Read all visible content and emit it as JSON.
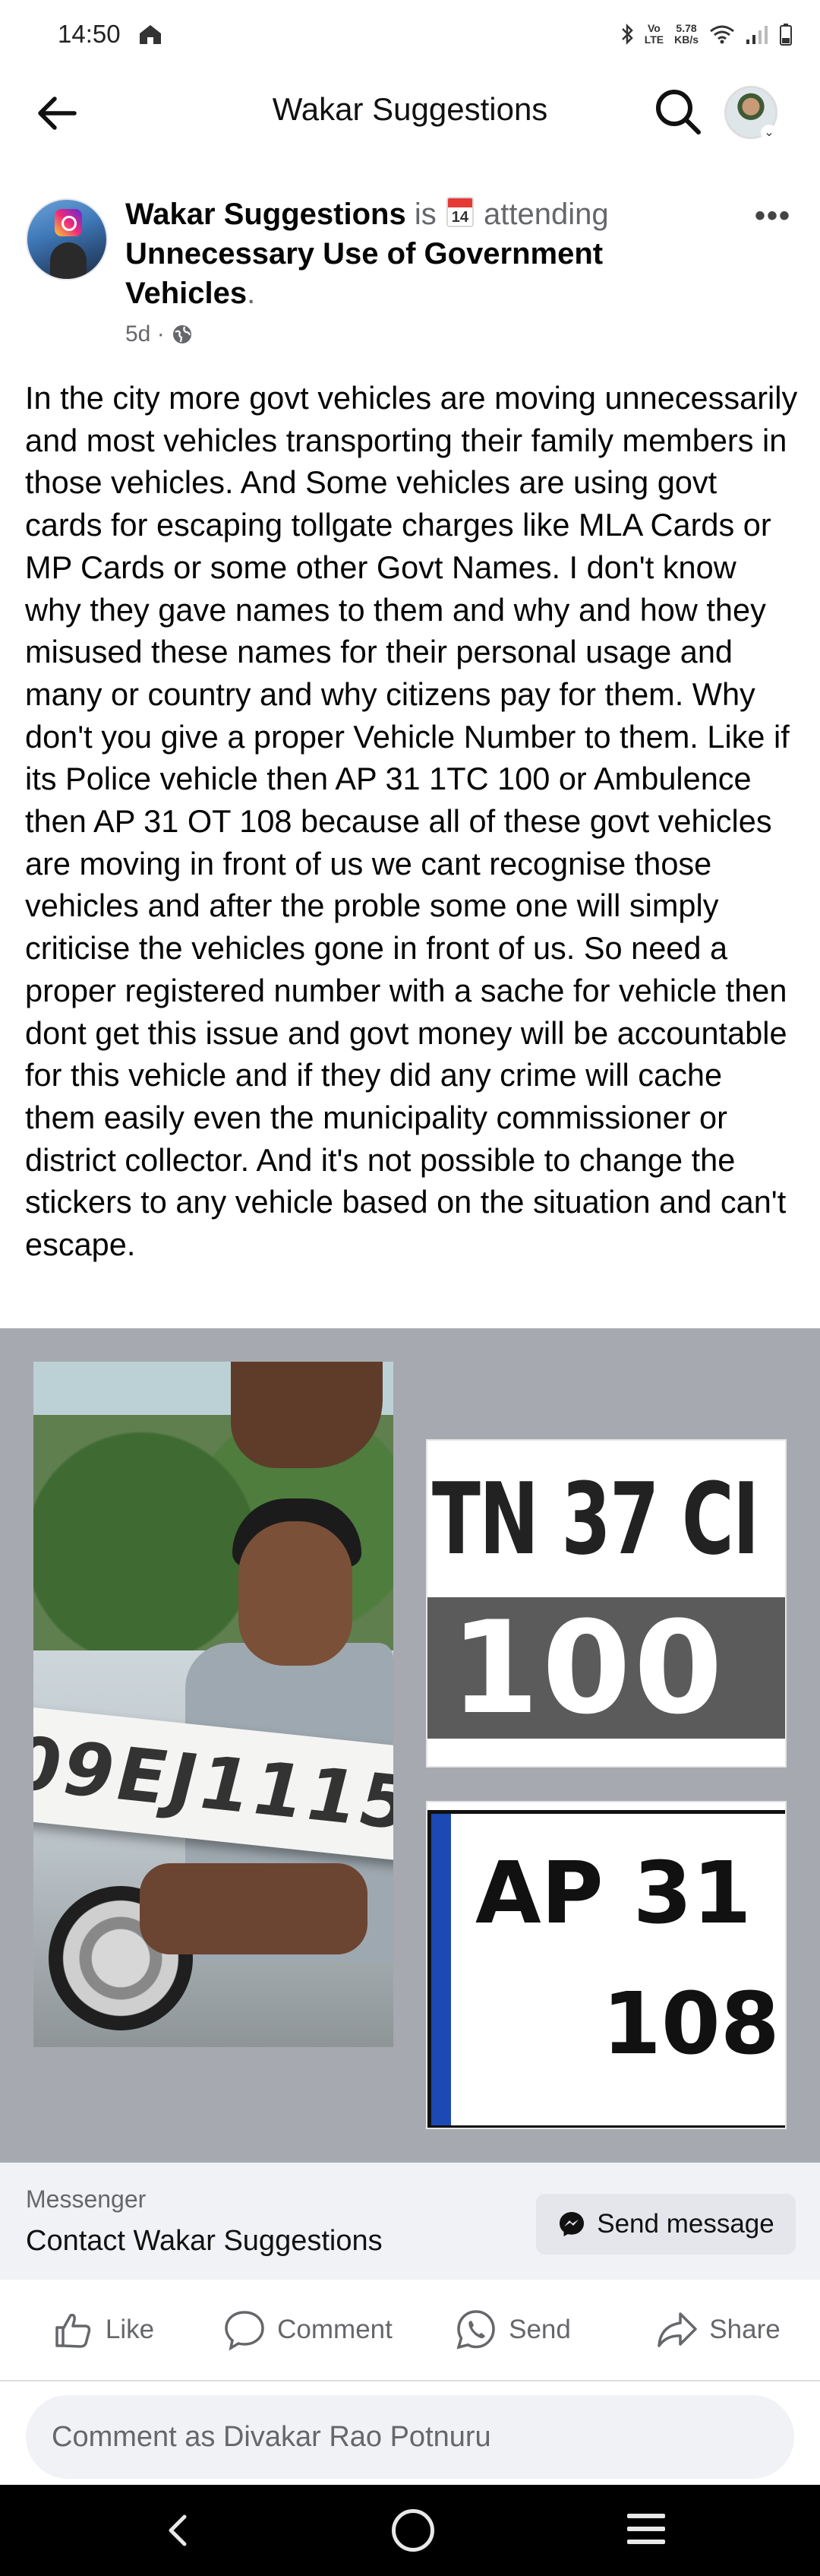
{
  "status_bar": {
    "time": "14:50",
    "network_top": "Vo",
    "network_bottom": "LTE",
    "speed_top": "5.78",
    "speed_bottom": "KB/s"
  },
  "app_bar": {
    "title": "Wakar Suggestions"
  },
  "post": {
    "author": "Wakar Suggestions",
    "verb_is": "is",
    "calendar_day": "14",
    "verb_attending": "attending",
    "event_name": "Unnecessary Use of Government Vehicles",
    "event_suffix": ".",
    "time_ago": "5d ·",
    "more_icon": "•••",
    "body": "In the city more govt vehicles are moving unnecessarily and most vehicles transporting their family members in those vehicles. And Some vehicles are using govt cards for escaping tollgate charges like MLA Cards or MP Cards or some other Govt Names. I don't know why they gave names to them and why and how they misused these names for their personal usage and many  or country and why citizens pay for them. Why don't you give a proper Vehicle Number to them. Like if its Police vehicle then AP 31 1TC 100 or Ambulence then AP 31 OT 108 because all of these govt vehicles are moving in front of us we cant recognise those vehicles and after the proble some one will simply criticise the vehicles gone in front of us. So need a proper registered number with a sache for vehicle then dont get this issue and govt money will be accountable for this vehicle and if they did any crime will cache them easily even the municipality commissioner or district collector. And it's not possible to change the stickers to any vehicle based on the situation and can't escape."
  },
  "images": {
    "left_plate_text": "09EJ1115",
    "top_plate_line1": "TN 37 CI",
    "top_plate_line2": "100",
    "bottom_plate_line1": "AP 31 (",
    "bottom_plate_line2": "108"
  },
  "messenger": {
    "label": "Messenger",
    "contact": "Contact Wakar Suggestions",
    "send_button": "Send message"
  },
  "actions": {
    "like": "Like",
    "comment": "Comment",
    "send": "Send",
    "share": "Share"
  },
  "composer": {
    "placeholder": "Comment as Divakar Rao Potnuru"
  },
  "colors": {
    "secondary_text": "#65676b",
    "surface": "#f0f2f5",
    "image_backdrop": "#a6aab0"
  }
}
